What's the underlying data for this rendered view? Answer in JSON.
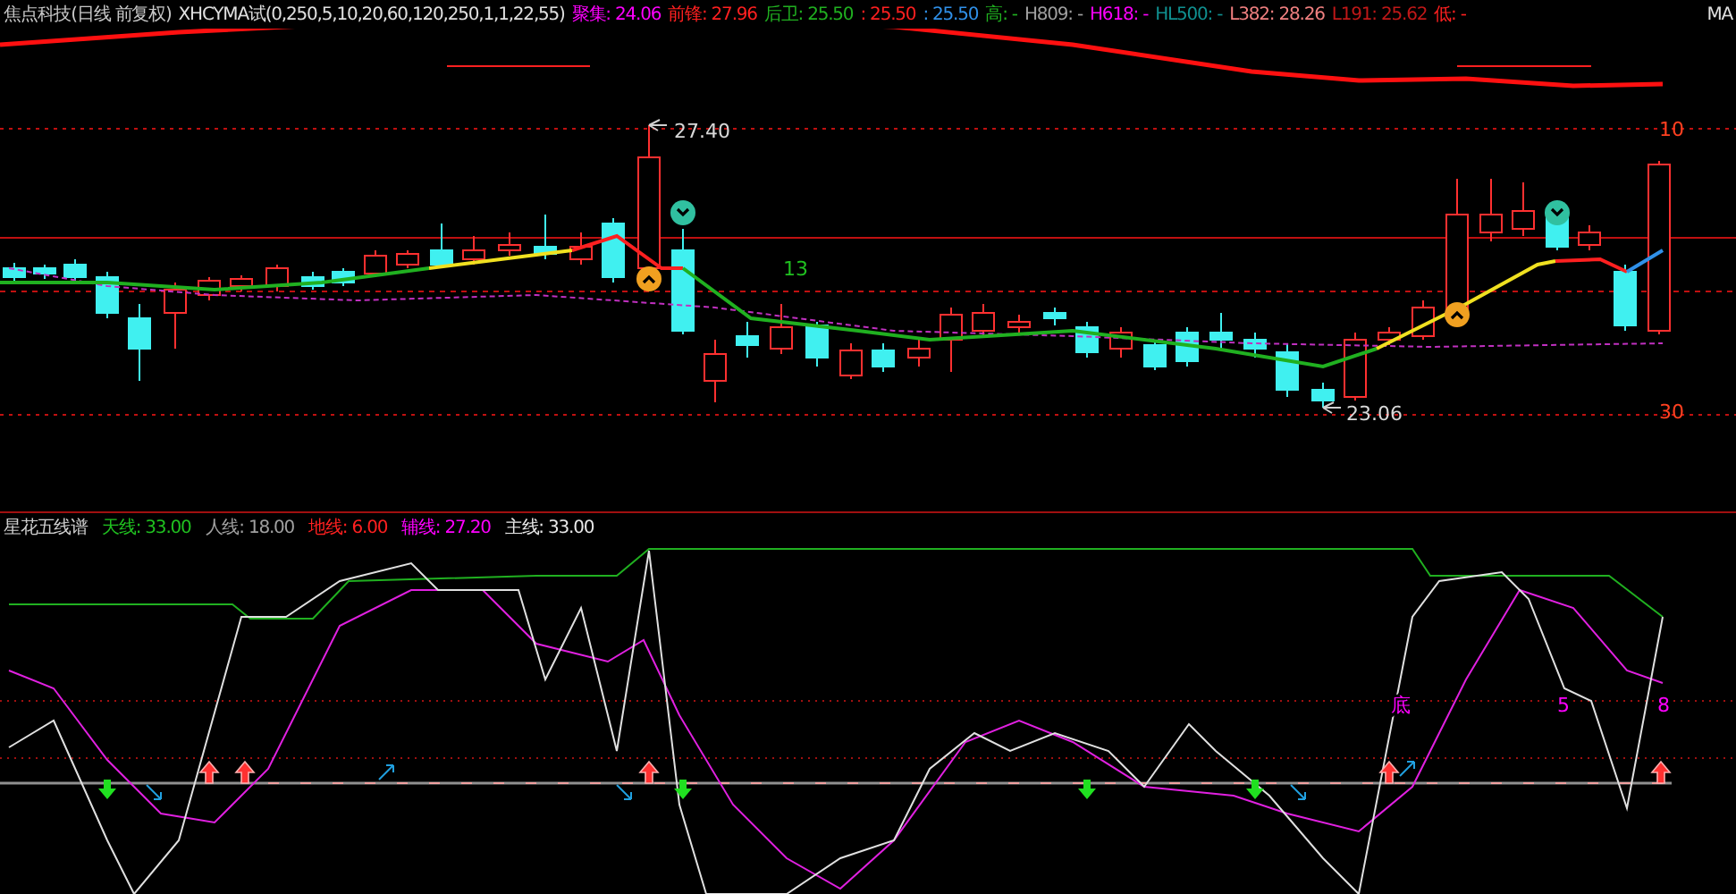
{
  "header": {
    "security": "焦点科技(日线 前复权)",
    "formula": "XHCYMA试(0,250,5,10,20,60,120,250,1,1,22,55)",
    "indicators": [
      {
        "text": "聚集: 24.06",
        "color": "#ff00ff"
      },
      {
        "text": "前锋: 27.96",
        "color": "#ff2020"
      },
      {
        "text": "后卫: 25.50",
        "color": "#20b020"
      },
      {
        "text": ": 25.50",
        "color": "#ff2020"
      },
      {
        "text": ": 25.50",
        "color": "#3090e8"
      },
      {
        "text": "高: -",
        "color": "#20b020"
      },
      {
        "text": "H809: -",
        "color": "#a0a0a0"
      },
      {
        "text": "H618: -",
        "color": "#ff00ff"
      },
      {
        "text": "HL500: -",
        "color": "#109090"
      },
      {
        "text": "L382: 28.26",
        "color": "#f08080"
      },
      {
        "text": "L191: 25.62",
        "color": "#c01818"
      },
      {
        "text": "低: -",
        "color": "#ff2020"
      }
    ],
    "corner": "MA"
  },
  "main_chart": {
    "labels": [
      {
        "text": "27.40",
        "color": "#d8d8d8"
      },
      {
        "text": "13",
        "color": "#20c020"
      },
      {
        "text": "23.06",
        "color": "#d8d8d8"
      },
      {
        "text": "10",
        "color": "#ff4020"
      },
      {
        "text": "30",
        "color": "#ff4020"
      }
    ]
  },
  "sub_header": {
    "title": "星花五线谱",
    "lines": [
      {
        "text": "天线: 33.00",
        "color": "#20c020"
      },
      {
        "text": "人线: 18.00",
        "color": "#a0a0a0"
      },
      {
        "text": "地线: 6.00",
        "color": "#ff2020"
      },
      {
        "text": "辅线: 27.20",
        "color": "#ff00ff"
      },
      {
        "text": "主线: 33.00",
        "color": "#e8e8e8"
      }
    ]
  },
  "sub_chart": {
    "labels": [
      {
        "text": "底",
        "color": "#ff00ff"
      },
      {
        "text": "5",
        "color": "#ff00ff"
      },
      {
        "text": "8",
        "color": "#ff00ff"
      }
    ]
  }
}
